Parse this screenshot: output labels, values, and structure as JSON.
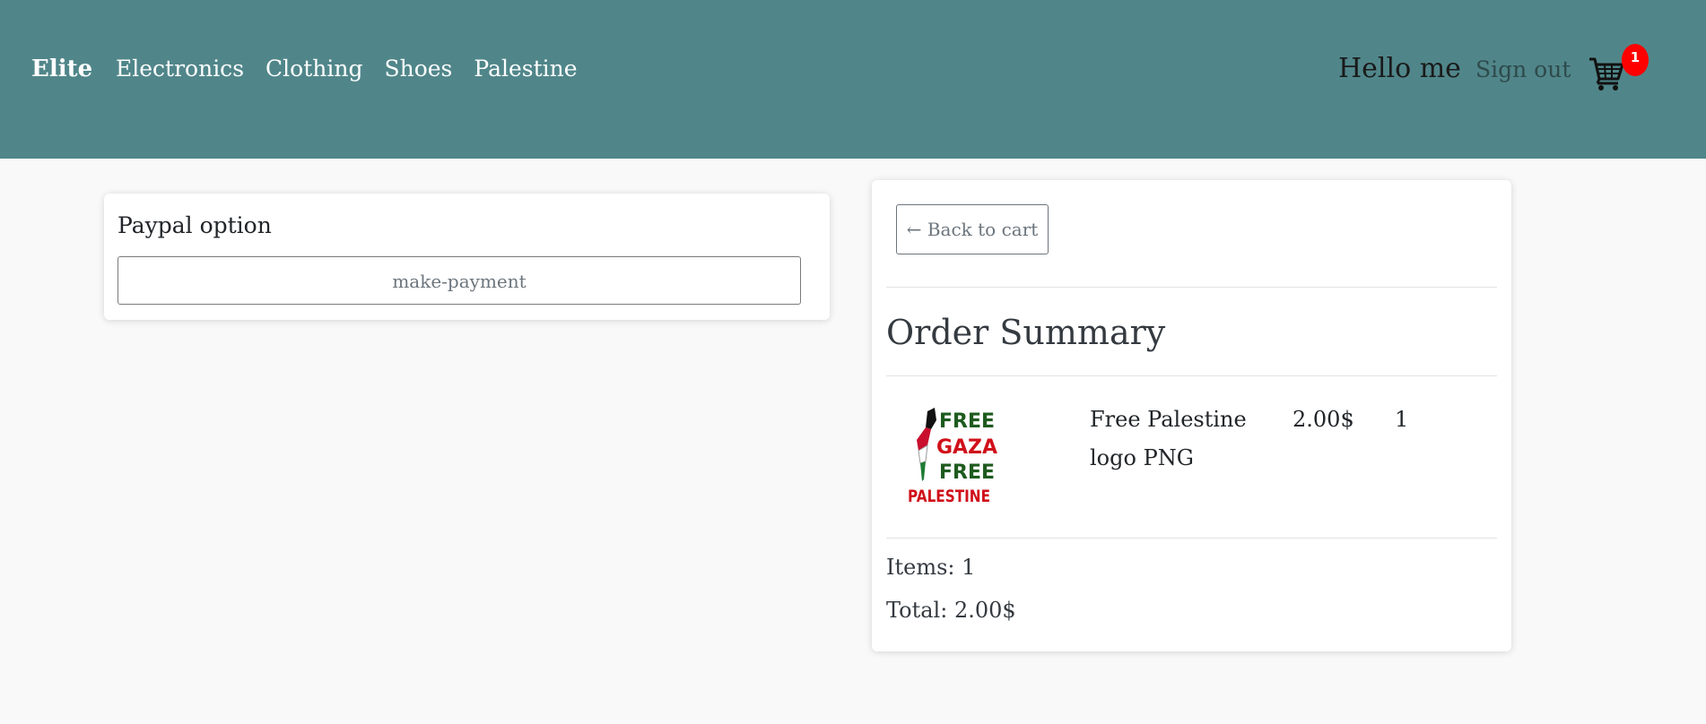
{
  "header": {
    "brand": "Elite",
    "nav_links": [
      "Electronics",
      "Clothing",
      "Shoes",
      "Palestine"
    ],
    "greeting": "Hello me",
    "signout_label": "Sign out",
    "cart_count": "1"
  },
  "payment": {
    "title": "Paypal option",
    "button_label": "make-payment"
  },
  "summary": {
    "back_label": "Back to cart",
    "title": "Order Summary",
    "items": [
      {
        "name": "Free Palestine logo PNG",
        "price": "2.00$",
        "quantity": "1",
        "image_text": [
          "FREE",
          "GAZA",
          "FREE",
          "PALESTINE"
        ]
      }
    ],
    "items_count_text": "Items: 1",
    "total_text": "Total: 2.00$"
  },
  "colors": {
    "navbar": "#50868a",
    "badge": "#ff0000"
  }
}
